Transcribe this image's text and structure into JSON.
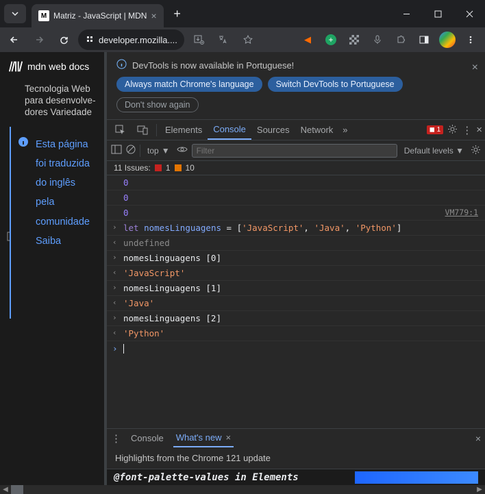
{
  "browser": {
    "tab_title": "Matriz - JavaScript | MDN",
    "url": "developer.mozilla...."
  },
  "mdn": {
    "logo_text": "mdn web docs",
    "nav_text": "Tec­no­lo­gia Web para de­sen­vol­ve­do­res Varie­dade",
    "notice_text": "Esta página foi traduzida do inglês pela comunidade Saiba"
  },
  "banner": {
    "info": "DevTools is now available in Portuguese!",
    "btn_match": "Always match Chrome's language",
    "btn_switch": "Switch DevTools to Portuguese",
    "btn_dismiss": "Don't show again"
  },
  "tabs": {
    "elements": "Elements",
    "console": "Console",
    "sources": "Sources",
    "network": "Network",
    "error_count": "1"
  },
  "consolebar": {
    "context": "top",
    "filter_ph": "Filter",
    "levels": "Default levels"
  },
  "issues": {
    "label": "11 Issues:",
    "errors": "1",
    "warnings": "10"
  },
  "output": {
    "zero": "0",
    "src": "VM779:1",
    "let": "let",
    "varname": "nomesLinguagens",
    "eq": " = [",
    "s1": "'JavaScript'",
    "s2": "'Java'",
    "s3": "'Python'",
    "close": "]",
    "undef": "undefined",
    "idx0": "nomesLinguagens [0]",
    "r0": "'JavaScript'",
    "idx1": "nomesLinguagens [1]",
    "r1": "'Java'",
    "idx2": "nomesLinguagens [2]",
    "r2": "'Python'"
  },
  "drawer": {
    "console": "Console",
    "whatsnew": "What's new",
    "highlights": "Highlights from the Chrome 121 update",
    "footer": "@font-palette-values in Elements"
  }
}
